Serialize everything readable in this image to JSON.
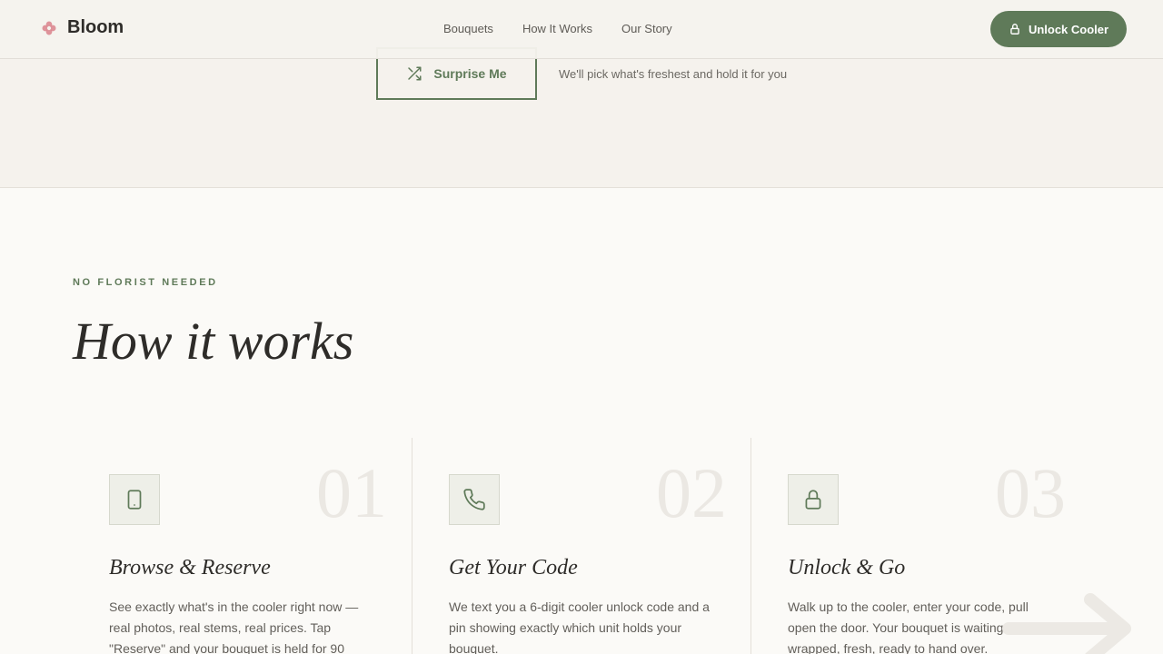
{
  "nav": {
    "brand": "Bloom",
    "links": [
      "Bouquets",
      "How It Works",
      "Our Story"
    ],
    "cta": "Unlock Cooler"
  },
  "hero": {
    "surprise_label": "Surprise Me",
    "surprise_note": "We'll pick what's freshest and hold it for you"
  },
  "how": {
    "eyebrow": "NO FLORIST NEEDED",
    "title": "How it works",
    "steps": [
      {
        "num": "01",
        "title": "Browse & Reserve",
        "body": "See exactly what's in the cooler right now — real photos, real stems, real prices. Tap \"Reserve\" and your bouquet is held for 90",
        "icon": "tablet-icon"
      },
      {
        "num": "02",
        "title": "Get Your Code",
        "body": "We text you a 6-digit cooler unlock code and a pin showing exactly which unit holds your bouquet.",
        "icon": "phone-icon"
      },
      {
        "num": "03",
        "title": "Unlock & Go",
        "body": "Walk up to the cooler, enter your code, pull open the door. Your bouquet is waiting — wrapped, fresh, ready to hand over.",
        "icon": "lock-icon"
      }
    ]
  },
  "colors": {
    "accent": "#5f7a59",
    "background": "#fbfaf7",
    "hero_bg": "#f5f2ed",
    "brand_flower": "#d9818b"
  }
}
